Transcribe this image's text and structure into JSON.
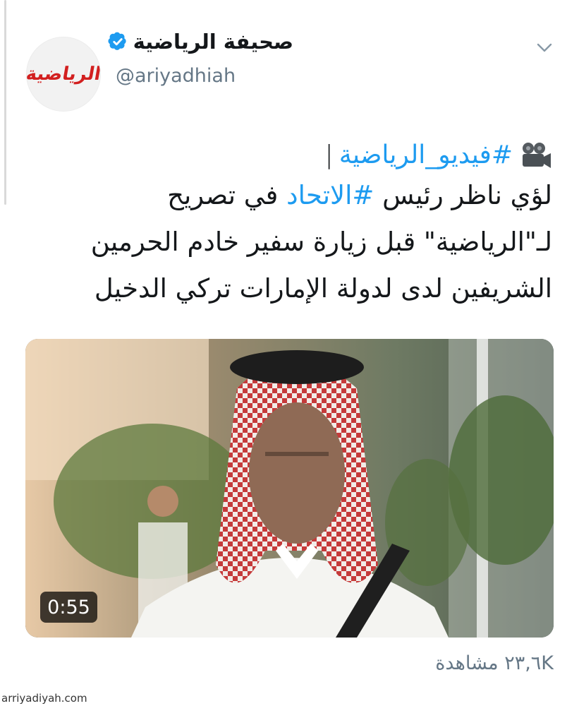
{
  "account": {
    "name": "صحيفة الرياضية",
    "handle": "@ariyadhiah",
    "avatar_text": "الرياضية",
    "verified": true
  },
  "tweet": {
    "hashtag_line": "#فيديو_الرياضية",
    "lines": [
      {
        "before": "لؤي ناظر رئيس ",
        "hashtag": "#الاتحاد",
        "after": " في تصريح"
      },
      {
        "text": "لـ\"الرياضية\" قبل زيارة سفير خادم الحرمين"
      },
      {
        "text": "الشريفين لدى لدولة الإمارات تركي الدخيل"
      }
    ]
  },
  "video": {
    "duration": "0:55"
  },
  "stats": {
    "views": "٢٣,٦K مشاهدة"
  },
  "watermark": "arriyadiyah.com",
  "colors": {
    "link": "#1d9bf0",
    "verified": "#1d9bf0",
    "secondary_text": "#657786",
    "logo_red": "#d21f1f"
  },
  "icons": [
    "chevron-down-icon",
    "verified-badge-icon",
    "movie-camera-icon"
  ]
}
